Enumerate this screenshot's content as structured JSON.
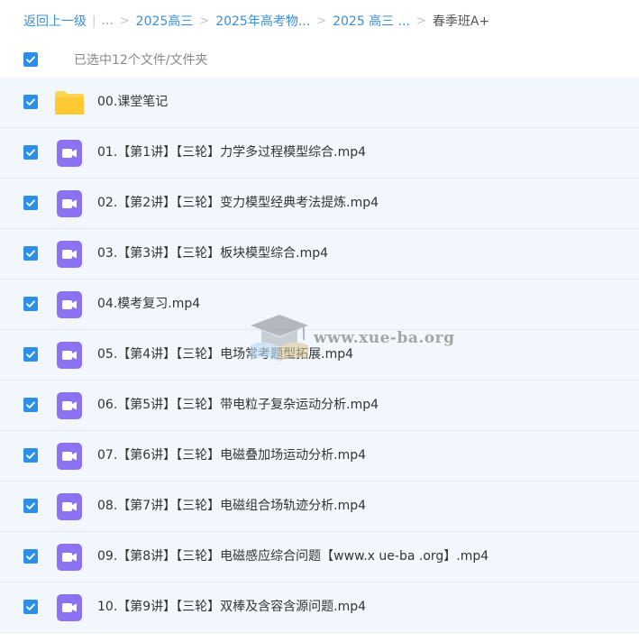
{
  "breadcrumb": {
    "back": "返回上一级",
    "sep_bar": "|",
    "ellipsis": "...",
    "sep": ">",
    "items": [
      "2025高三",
      "2025年高考物...",
      "2025 高三 ..."
    ],
    "current": "春季班A+"
  },
  "selection": {
    "label": "已选中12个文件/文件夹",
    "all_checked": true
  },
  "files": [
    {
      "name": "00.课堂笔记",
      "type": "folder",
      "checked": true
    },
    {
      "name": "01.【第1讲】【三轮】力学多过程模型综合.mp4",
      "type": "video",
      "checked": true
    },
    {
      "name": "02.【第2讲】【三轮】变力模型经典考法提炼.mp4",
      "type": "video",
      "checked": true
    },
    {
      "name": "03.【第3讲】【三轮】板块模型综合.mp4",
      "type": "video",
      "checked": true
    },
    {
      "name": "04.模考复习.mp4",
      "type": "video",
      "checked": true
    },
    {
      "name": "05.【第4讲】【三轮】电场常考题型拓展.mp4",
      "type": "video",
      "checked": true
    },
    {
      "name": "06.【第5讲】【三轮】带电粒子复杂运动分析.mp4",
      "type": "video",
      "checked": true
    },
    {
      "name": "07.【第6讲】【三轮】电磁叠加场运动分析.mp4",
      "type": "video",
      "checked": true
    },
    {
      "name": "08.【第7讲】【三轮】电磁组合场轨迹分析.mp4",
      "type": "video",
      "checked": true
    },
    {
      "name": "09.【第8讲】【三轮】电磁感应综合问题【www.x ue-ba .org】.mp4",
      "type": "video",
      "checked": true
    },
    {
      "name": "10.【第9讲】【三轮】双棒及含容含源问题.mp4",
      "type": "video",
      "checked": true
    }
  ],
  "icons": {
    "folder": "folder-icon",
    "video": "video-file-icon",
    "checkbox": "checkbox-checked-icon"
  },
  "colors": {
    "link": "#3b8fd8",
    "checkbox": "#2d8ee8",
    "row_selected_bg": "#f1f7fd",
    "folder": "#ffd451",
    "video_icon": "#8b72f2"
  },
  "watermark": {
    "text": "www.xue-ba.org"
  }
}
